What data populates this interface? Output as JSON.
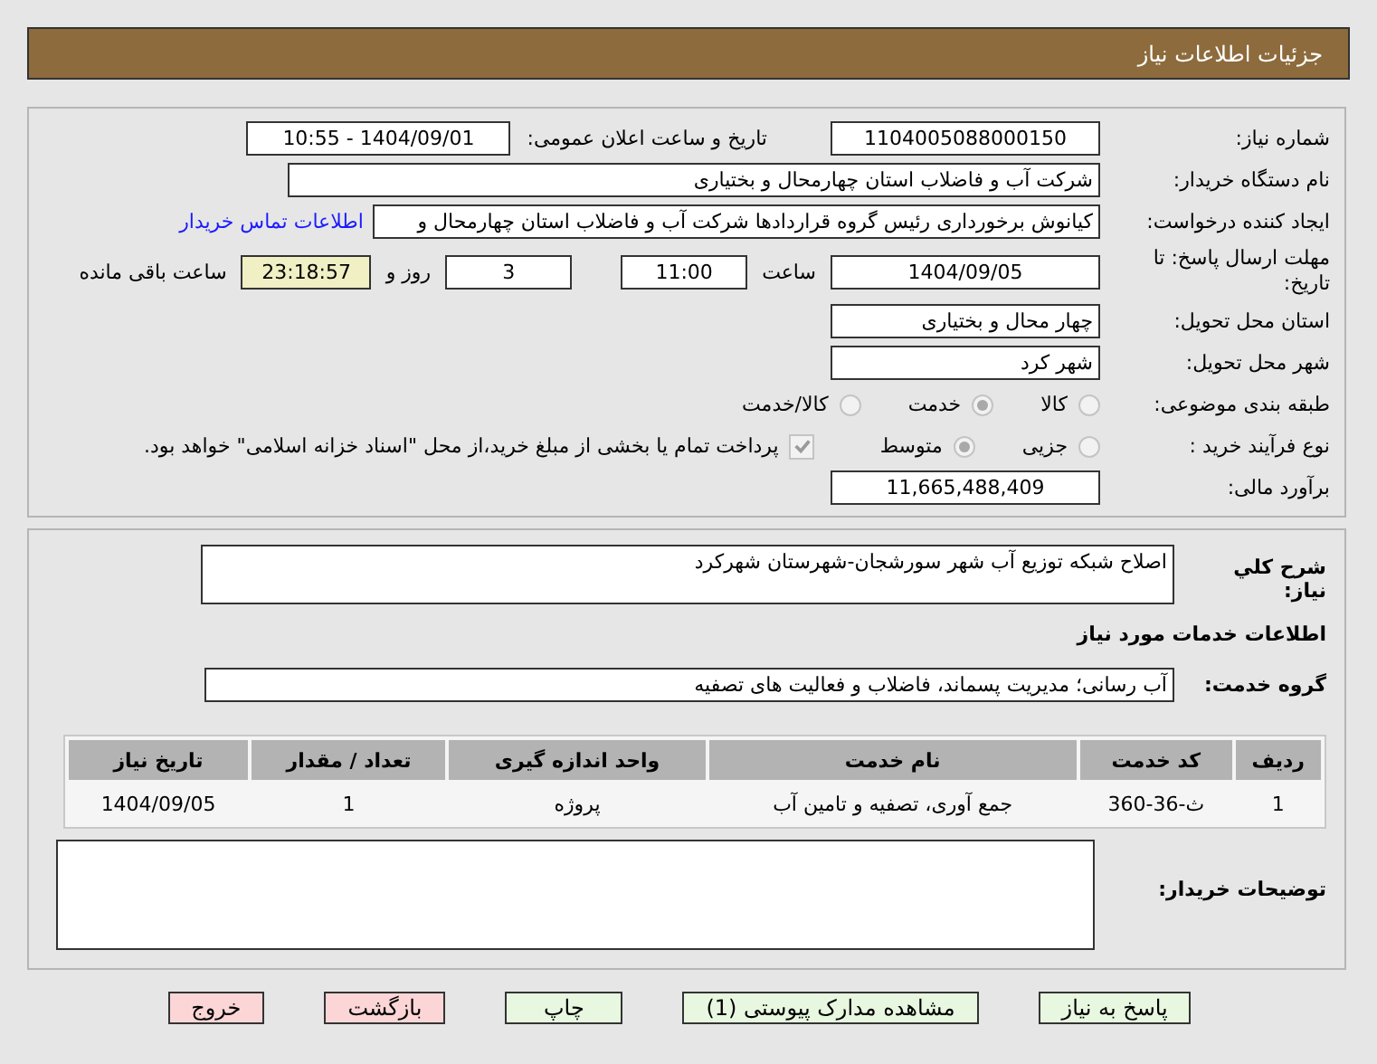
{
  "header": {
    "title": "جزئیات اطلاعات نیاز"
  },
  "need_number": {
    "label": "شماره نیاز:",
    "value": "1104005088000150"
  },
  "announce": {
    "label": "تاریخ و ساعت اعلان عمومی:",
    "value": "1404/09/01 - 10:55"
  },
  "buyer": {
    "label": "نام دستگاه خریدار:",
    "value": "شرکت آب و فاضلاب استان چهارمحال و بختیاری"
  },
  "requester": {
    "label": "ایجاد کننده درخواست:",
    "value": "کیانوش برخورداری رئیس گروه قراردادها شرکت آب و فاضلاب استان چهارمحال و",
    "link": "اطلاعات تماس خریدار"
  },
  "deadline": {
    "label": "مهلت ارسال پاسخ: تا تاریخ:",
    "date": "1404/09/05",
    "time_label": "ساعت",
    "time": "11:00",
    "days": "3",
    "days_label": "روز و",
    "remaining": "23:18:57",
    "remaining_label": "ساعت باقی مانده"
  },
  "province": {
    "label": "استان محل تحویل:",
    "value": "چهار محال و بختیاری"
  },
  "city": {
    "label": "شهر محل تحویل:",
    "value": "شهر کرد"
  },
  "category": {
    "label": "طبقه بندی موضوعی:",
    "options": [
      {
        "label": "کالا",
        "selected": false
      },
      {
        "label": "خدمت",
        "selected": true
      },
      {
        "label": "کالا/خدمت",
        "selected": false
      }
    ]
  },
  "purchase_type": {
    "label": "نوع فرآیند خرید :",
    "options": [
      {
        "label": "جزیی",
        "selected": false
      },
      {
        "label": "متوسط",
        "selected": true
      }
    ],
    "treasury": {
      "label": "پرداخت تمام یا بخشی از مبلغ خرید،از محل \"اسناد خزانه اسلامی\" خواهد بود.",
      "checked": true
    }
  },
  "budget": {
    "label": "برآورد مالی:",
    "value": "11,665,488,409"
  },
  "description": {
    "label": "شرح کلي نیاز:",
    "value": "اصلاح شبکه توزیع آب شهر سورشجان-شهرستان شهرکرد"
  },
  "services_heading": "اطلاعات خدمات مورد نیاز",
  "service_group": {
    "label": "گروه خدمت:",
    "value": "آب رسانی؛ مدیریت پسماند، فاضلاب و فعالیت های تصفیه"
  },
  "table": {
    "columns": [
      "ردیف",
      "کد خدمت",
      "نام خدمت",
      "واحد اندازه گیری",
      "تعداد / مقدار",
      "تاریخ نیاز"
    ],
    "rows": [
      [
        "1",
        "ث-36-360",
        "جمع آوری، تصفیه و تامین آب",
        "پروژه",
        "1",
        "1404/09/05"
      ]
    ]
  },
  "notes": {
    "label": "توضیحات خریدار:"
  },
  "buttons": [
    {
      "label": "پاسخ به نیاز",
      "kind": "primary"
    },
    {
      "label": "مشاهده مدارک پیوستی (1)",
      "kind": "primary"
    },
    {
      "label": "چاپ",
      "kind": "primary"
    },
    {
      "label": "بازگشت",
      "kind": "danger"
    },
    {
      "label": "خروج",
      "kind": "danger"
    }
  ]
}
